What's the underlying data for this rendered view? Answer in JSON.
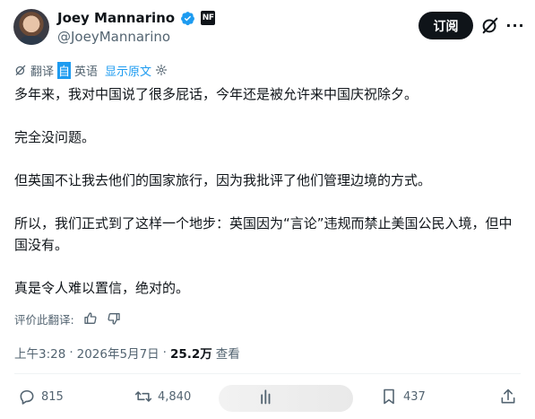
{
  "tweet": {
    "author": {
      "display_name": "Joey Mannarino",
      "handle": "@JoeyMannarino",
      "verified_icon": "verified-badge-icon",
      "affiliation_badge": "NF"
    },
    "follow_label": "订阅",
    "translation": {
      "translated_prefix": "翻译",
      "translated_highlight": "自",
      "translated_suffix": "英语",
      "show_original": "显示原文"
    },
    "paragraphs": [
      "多年来，我对中国说了很多屁话，今年还是被允许来中国庆祝除夕。",
      "完全没问题。",
      "但英国不让我去他们的国家旅行，因为我批评了他们管理边境的方式。",
      "所以，我们正式到了这样一个地步：英国因为“言论”违规而禁止美国公民入境，但中国没有。",
      "真是令人难以置信，绝对的。"
    ],
    "rate_translation_label": "评价此翻译:",
    "meta": {
      "time": "上午3:28",
      "separator": "·",
      "date": "2026年5月7日",
      "views_count": "25.2万",
      "views_label": "查看"
    },
    "actions": {
      "replies": "815",
      "reposts": "4,840",
      "likes": "",
      "bookmarks": "437"
    },
    "colors": {
      "text_primary": "#0f1419",
      "text_secondary": "#536471",
      "accent": "#1d9bf0",
      "follow_bg": "#0f1419"
    }
  }
}
